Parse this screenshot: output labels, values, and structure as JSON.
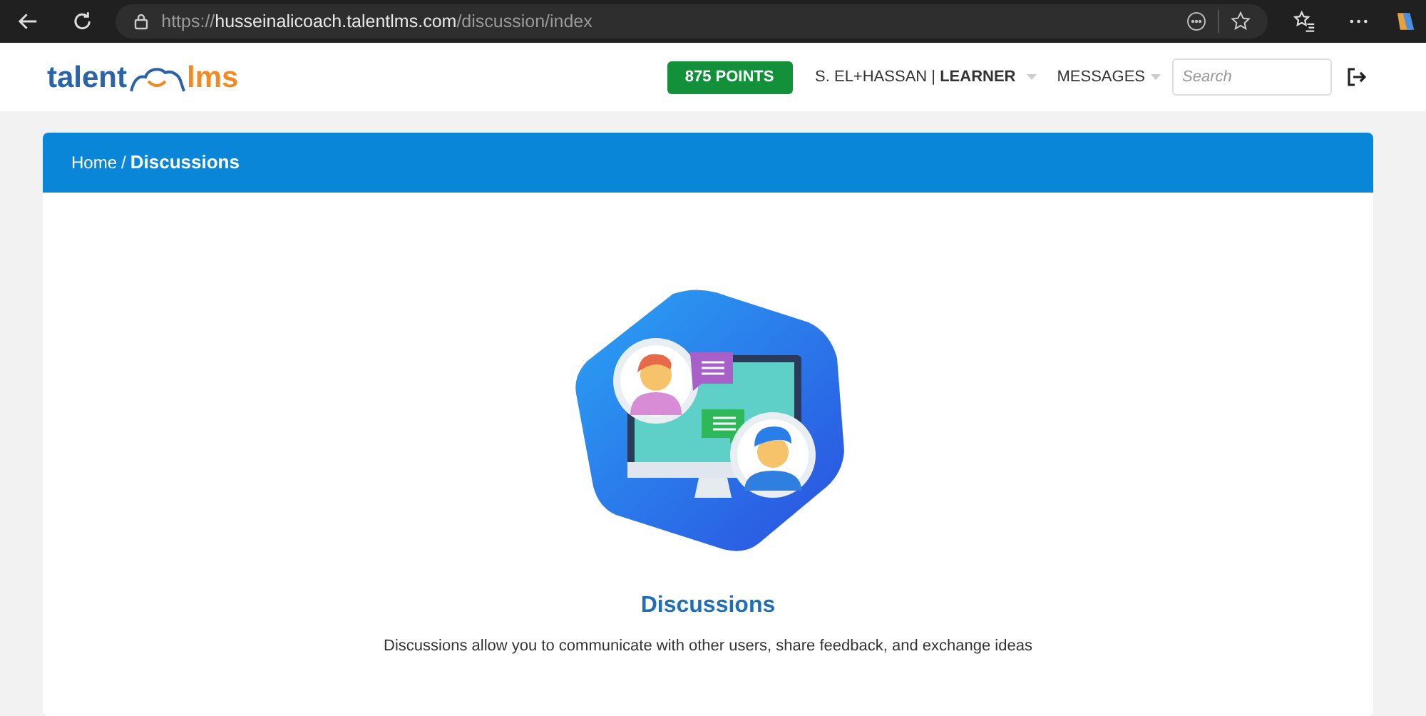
{
  "browser": {
    "url": {
      "scheme": "https://",
      "host": "husseinalicoach.talentlms.com",
      "path": "/discussion/index"
    }
  },
  "header": {
    "logo": {
      "left": "talent",
      "right": "lms"
    },
    "points": "875 POINTS",
    "user": {
      "name": "S. EL+HASSAN",
      "separator": "|",
      "role": "LEARNER"
    },
    "messages": "MESSAGES",
    "search": {
      "placeholder": "Search"
    }
  },
  "breadcrumb": {
    "home": "Home",
    "separator": "/",
    "current": "Discussions"
  },
  "empty_state": {
    "title": "Discussions",
    "description": "Discussions allow you to communicate with other users, share feedback, and exchange ideas"
  }
}
